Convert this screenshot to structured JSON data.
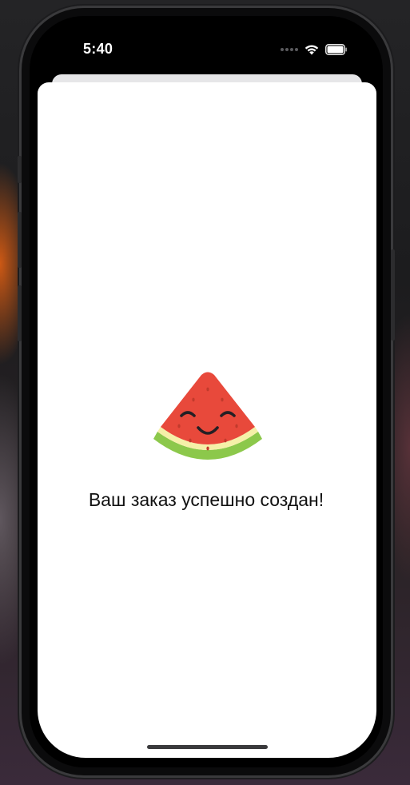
{
  "status_bar": {
    "time": "5:40",
    "icons": [
      "signal-dots-icon",
      "wifi-icon",
      "battery-icon"
    ]
  },
  "screen": {
    "illustration": "watermelon-slice-icon",
    "message": "Ваш заказ успешно создан!"
  },
  "colors": {
    "melon_flesh": "#e8493b",
    "melon_rind": "#8cc84b",
    "melon_pith": "#f5f0a8",
    "text": "#111111",
    "sheet_bg": "#ffffff"
  }
}
